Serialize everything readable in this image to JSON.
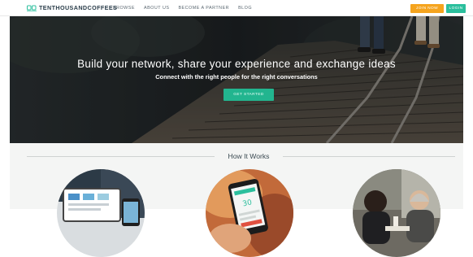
{
  "brand": {
    "name": "TENTHOUSANDCOFFEES",
    "icon": "cups-logo-icon"
  },
  "nav": {
    "links": [
      {
        "label": "BROWSE"
      },
      {
        "label": "ABOUT US"
      },
      {
        "label": "BECOME A PARTNER"
      },
      {
        "label": "BLOG"
      }
    ],
    "join_label": "JOIN NOW",
    "login_label": "LOGIN"
  },
  "hero": {
    "title": "Build your network, share your experience and exchange ideas",
    "subtitle": "Connect with the right people for the right conversations",
    "cta_label": "GET STARTED"
  },
  "how": {
    "title": "How It Works",
    "steps": [
      {
        "image": "devices-photo"
      },
      {
        "image": "phone-photo"
      },
      {
        "image": "people-photo"
      }
    ]
  },
  "colors": {
    "accent_green": "#22b58f",
    "accent_orange": "#f5a41e",
    "brand_dark": "#2a3d4a"
  }
}
